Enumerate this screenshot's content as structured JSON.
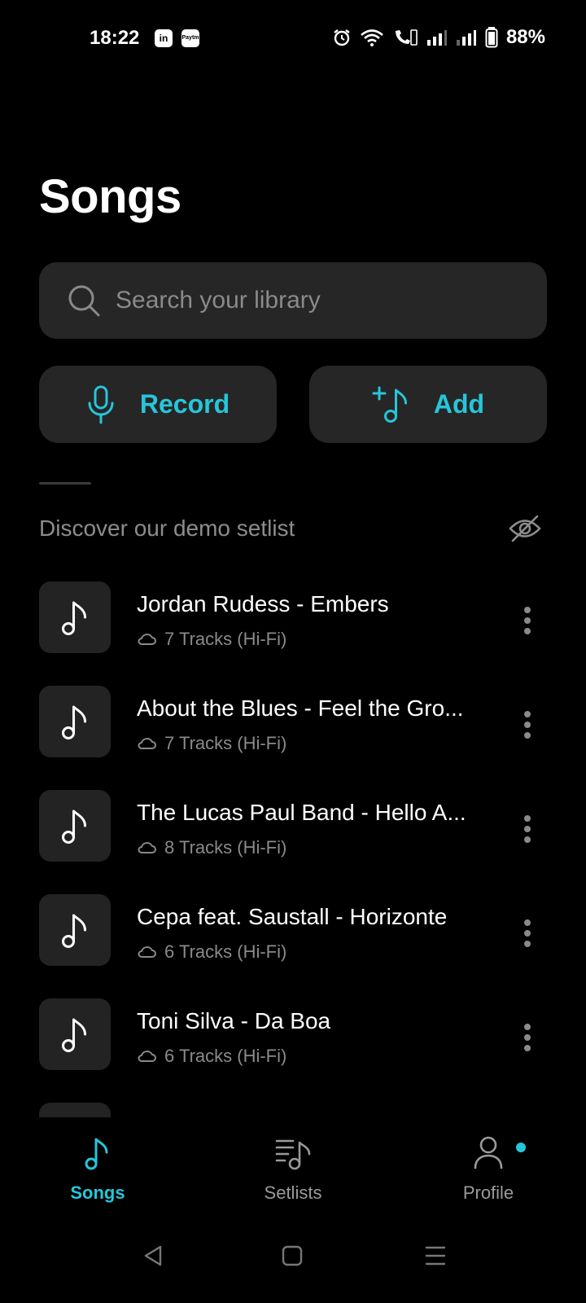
{
  "status_bar": {
    "time": "18:22",
    "app_icons": [
      "in",
      "Paytm"
    ],
    "battery": "88%"
  },
  "page": {
    "title": "Songs"
  },
  "search": {
    "placeholder": "Search your library"
  },
  "actions": {
    "record_label": "Record",
    "add_label": "Add"
  },
  "section": {
    "title": "Discover our demo setlist"
  },
  "songs": [
    {
      "title": "Jordan Rudess - Embers",
      "subtitle": "7 Tracks (Hi-Fi)"
    },
    {
      "title": "About the Blues - Feel the Gro...",
      "subtitle": "7 Tracks (Hi-Fi)"
    },
    {
      "title": "The Lucas Paul Band - Hello A...",
      "subtitle": "8 Tracks (Hi-Fi)"
    },
    {
      "title": "Cepa feat. Saustall - Horizonte",
      "subtitle": "6 Tracks (Hi-Fi)"
    },
    {
      "title": "Toni Silva - Da Boa",
      "subtitle": "6 Tracks (Hi-Fi)"
    }
  ],
  "nav": {
    "songs": "Songs",
    "setlists": "Setlists",
    "profile": "Profile"
  },
  "colors": {
    "accent": "#26c6da",
    "surface": "#262626",
    "background": "#000000"
  }
}
